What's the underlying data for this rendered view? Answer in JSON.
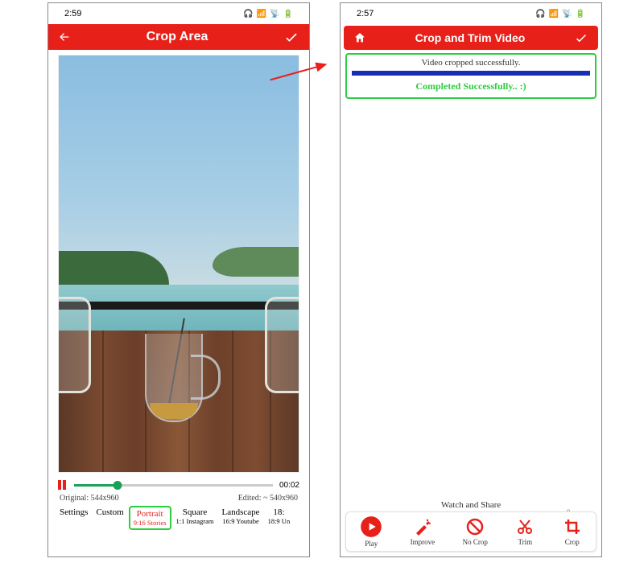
{
  "left": {
    "status_time": "2:59",
    "header_title": "Crop Area",
    "time_elapsed": "00:02",
    "original_label": "Original: 544x960",
    "edited_label": "Edited: ~ 540x960",
    "ratios": {
      "settings": "Settings",
      "custom": "Custom",
      "portrait": {
        "label": "Portrait",
        "sub": "9:16 Stories"
      },
      "square": {
        "label": "Square",
        "sub": "1:1 Instagram"
      },
      "landscape": {
        "label": "Landscape",
        "sub": "16:9 Youtube"
      },
      "more": {
        "label": "18:",
        "sub": "18:9 Un"
      }
    }
  },
  "right": {
    "status_time": "2:57",
    "header_title": "Crop and Trim Video",
    "msg_cropped": "Video cropped successfully.",
    "msg_done": "Completed Successfully.. :)",
    "watch_share": "Watch and Share",
    "actions": {
      "play": "Play",
      "improve": "Improve",
      "nocrop": "No Crop",
      "trim": "Trim",
      "crop": "Crop"
    }
  }
}
